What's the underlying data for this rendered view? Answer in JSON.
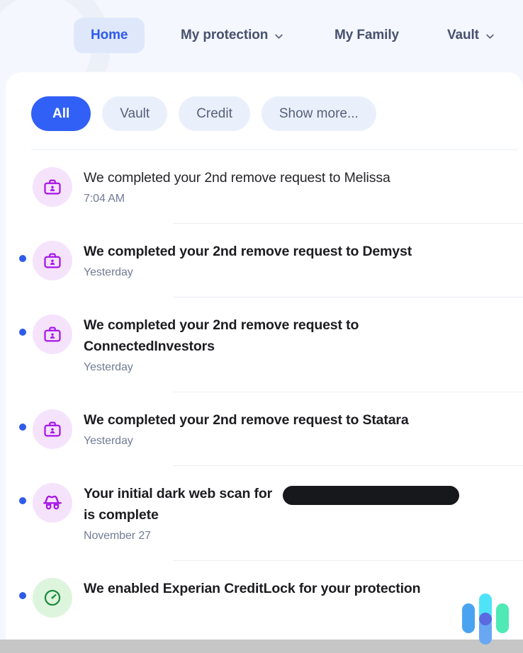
{
  "header": {
    "nav_items": [
      {
        "label": "Home",
        "active": true,
        "has_chevron": false,
        "icon": "none"
      },
      {
        "label": "My protection",
        "active": false,
        "has_chevron": true,
        "icon": "chevron-down-icon"
      },
      {
        "label": "My Family",
        "active": false,
        "has_chevron": false,
        "icon": "none"
      },
      {
        "label": "Vault",
        "active": false,
        "has_chevron": true,
        "icon": "chevron-down-icon"
      }
    ],
    "accent_color": "#2f5bea",
    "active_pill_bg": "#dfe8fb",
    "nav_text_color": "#47516f",
    "background_color": "#f4f7fd"
  },
  "filters": {
    "items": [
      {
        "label": "All",
        "active": true
      },
      {
        "label": "Vault",
        "active": false
      },
      {
        "label": "Credit",
        "active": false
      },
      {
        "label": "Show more...",
        "active": false
      }
    ],
    "active_bg": "#3160f6",
    "inactive_bg": "#eaf0fb"
  },
  "notifications": {
    "items": [
      {
        "title": "We completed your 2nd remove request to Melissa",
        "time": "7:04 AM",
        "unread": false,
        "icon": "briefcase-person-icon",
        "icon_color": "#a714e8",
        "icon_bg": "#f5e3fc",
        "redacted": false
      },
      {
        "title": "We completed your 2nd remove request to Demyst",
        "time": "Yesterday",
        "unread": true,
        "icon": "briefcase-person-icon",
        "icon_color": "#a714e8",
        "icon_bg": "#f5e3fc",
        "redacted": false
      },
      {
        "title": "We completed your 2nd remove request to ConnectedInvestors",
        "time": "Yesterday",
        "unread": true,
        "icon": "briefcase-person-icon",
        "icon_color": "#a714e8",
        "icon_bg": "#f5e3fc",
        "redacted": false
      },
      {
        "title": "We completed your 2nd remove request to Statara",
        "time": "Yesterday",
        "unread": true,
        "icon": "briefcase-person-icon",
        "icon_color": "#a714e8",
        "icon_bg": "#f5e3fc",
        "redacted": false
      },
      {
        "title": "Your initial dark web scan for is complete",
        "title_before_redaction": "Your initial dark web scan for",
        "title_after_redaction": "is complete",
        "time": "November 27",
        "unread": true,
        "icon": "incognito-icon",
        "icon_color": "#a714e8",
        "icon_bg": "#f5e3fc",
        "redacted": true
      },
      {
        "title": "We enabled Experian CreditLock for your protection",
        "time": "",
        "unread": true,
        "icon": "speedometer-icon",
        "icon_color": "#1b8a3c",
        "icon_bg": "#ddf5dc",
        "redacted": false
      }
    ],
    "unread_dot_color": "#2f5bea"
  },
  "widget": {
    "name": "assistant-widget",
    "bar_colors": [
      "#4aa3f0",
      "#4fe3f7",
      "#4fe9b5"
    ],
    "dot_color": "#5b6ae0"
  }
}
